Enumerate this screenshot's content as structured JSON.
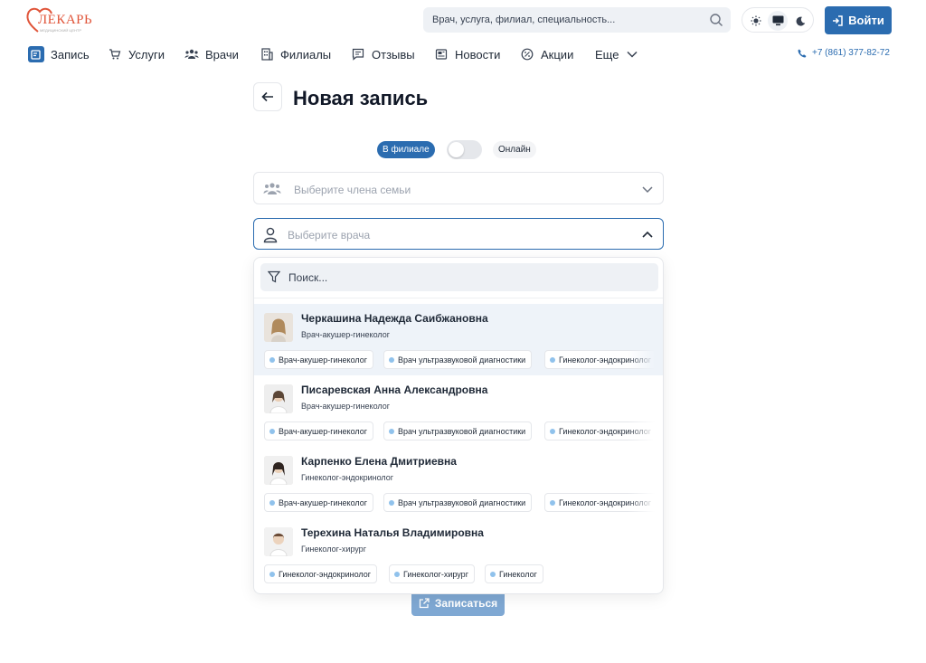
{
  "brand": {
    "logo_text": "ЛЕКАРЬ",
    "logo_sub": "МЕДИЦИНСКИЙ ЦЕНТР",
    "accent": "#2b6cb0",
    "logo_color": "#e0553a"
  },
  "header": {
    "search_placeholder": "Врач, услуга, филиал, специальность...",
    "theme_options": [
      "light",
      "system",
      "dark"
    ],
    "theme_active": "system",
    "login_label": "Войти"
  },
  "nav": {
    "items": [
      {
        "label": "Запись",
        "icon": "calendar-edit-icon"
      },
      {
        "label": "Услуги",
        "icon": "cart-icon"
      },
      {
        "label": "Врачи",
        "icon": "users-icon"
      },
      {
        "label": "Филиалы",
        "icon": "building-icon"
      },
      {
        "label": "Отзывы",
        "icon": "message-icon"
      },
      {
        "label": "Новости",
        "icon": "newspaper-icon"
      },
      {
        "label": "Акции",
        "icon": "discount-icon"
      },
      {
        "label": "Еще",
        "icon": "chevron-down-icon"
      }
    ],
    "phone": "+7 (861) 377-82-72"
  },
  "page": {
    "title": "Новая запись",
    "mode": {
      "left": "В филиале",
      "right": "Онлайн",
      "toggle_on": false
    }
  },
  "form": {
    "family_placeholder": "Выберите члена семьи",
    "doctor_placeholder": "Выберите врача",
    "submit_label": "Записаться"
  },
  "dropdown": {
    "search_placeholder": "Поиск...",
    "doctors": [
      {
        "name": "Черкашина Надежда Саибжановна",
        "specialty": "Врач-акушер-гинеколог",
        "tags": [
          "Врач-акушер-гинеколог",
          "Врач ультразвуковой диагностики",
          "Гинеколог-эндокринолог"
        ],
        "highlighted": true
      },
      {
        "name": "Писаревская Анна Александровна",
        "specialty": "Врач-акушер-гинеколог",
        "tags": [
          "Врач-акушер-гинеколог",
          "Врач ультразвуковой диагностики",
          "Гинеколог-эндокринолог"
        ],
        "highlighted": false
      },
      {
        "name": "Карпенко Елена Дмитриевна",
        "specialty": "Гинеколог-эндокринолог",
        "tags": [
          "Врач-акушер-гинеколог",
          "Врач ультразвуковой диагностики",
          "Гинеколог-эндокринолог"
        ],
        "highlighted": false
      },
      {
        "name": "Терехина Наталья Владимировна",
        "specialty": "Гинеколог-хирург",
        "tags": [
          "Гинеколог-эндокринолог",
          "Гинеколог-хирург",
          "Гинеколог"
        ],
        "highlighted": false
      }
    ]
  }
}
